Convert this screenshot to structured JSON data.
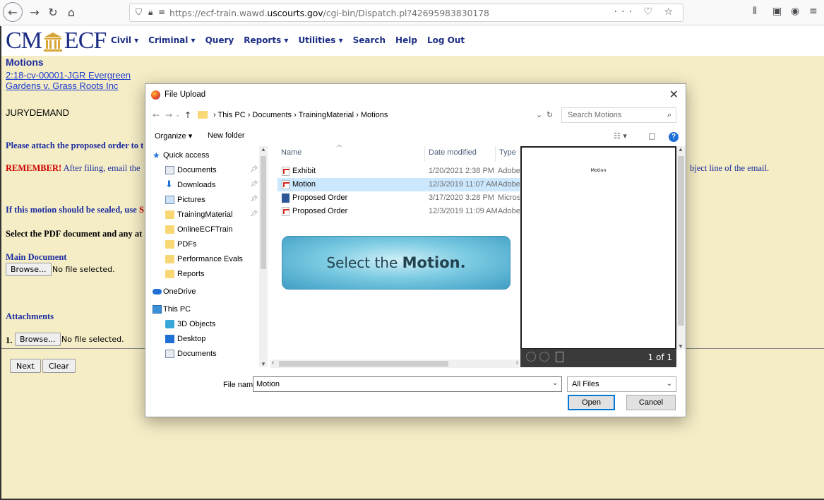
{
  "browser": {
    "url_prefix": "https://ecf-train.wawd.",
    "url_domain": "uscourts.gov",
    "url_suffix": "/cgi-bin/Dispatch.pl?42695983830178",
    "url_tools": "··· ♡ ☆"
  },
  "ecf": {
    "logo_left": "CM",
    "logo_right": "ECF",
    "menu": [
      "Civil ▾",
      "Criminal ▾",
      "Query",
      "Reports ▾",
      "Utilities ▾",
      "Search",
      "Help",
      "Log Out"
    ],
    "page_title": "Motions",
    "case_link_line1": "2:18-cv-00001-JGR Evergreen",
    "case_link_line2": "Gardens v. Grass Roots Inc",
    "jury_demand": "JURYDEMAND",
    "attach_prompt": "Please attach the proposed order to t",
    "remember_label": "REMEMBER!",
    "remember_text": " After filing, email the",
    "remember_tail": "bject line of the email.",
    "sealed_text": "If this motion should be sealed, use ",
    "sealed_red": "S",
    "select_text": "Select the PDF document and any at",
    "main_document": "Main Document",
    "browse_label": "Browse...",
    "no_file": "No file selected.",
    "attachments_title": "Attachments",
    "attachment_num": "1.",
    "next_label": "Next",
    "clear_label": "Clear"
  },
  "dialog": {
    "title": "File Upload",
    "close": "✕",
    "breadcrumb": "›  This PC  ›  Documents  ›  TrainingMaterial  ›  Motions",
    "search_placeholder": "Search Motions",
    "organize": "Organize ▾",
    "new_folder": "New folder",
    "nav": [
      {
        "label": "Quick access",
        "icon": "star-icon",
        "pinned": false
      },
      {
        "label": "Documents",
        "icon": "documents-icon",
        "pinned": true
      },
      {
        "label": "Downloads",
        "icon": "download-icon",
        "pinned": true
      },
      {
        "label": "Pictures",
        "icon": "pictures-icon",
        "pinned": true
      },
      {
        "label": "TrainingMaterial",
        "icon": "folder-icon",
        "pinned": true
      },
      {
        "label": "OnlineECFTrain",
        "icon": "folder-icon",
        "pinned": false
      },
      {
        "label": "PDFs",
        "icon": "folder-icon",
        "pinned": false
      },
      {
        "label": "Performance Evals",
        "icon": "folder-icon",
        "pinned": false
      },
      {
        "label": "Reports",
        "icon": "folder-icon",
        "pinned": false
      },
      {
        "label": "OneDrive",
        "icon": "cloud-icon",
        "pinned": false
      },
      {
        "label": "This PC",
        "icon": "computer-icon",
        "pinned": false
      },
      {
        "label": "3D Objects",
        "icon": "3d-objects-icon",
        "pinned": false
      },
      {
        "label": "Desktop",
        "icon": "desktop-icon",
        "pinned": false
      },
      {
        "label": "Documents",
        "icon": "documents-icon",
        "pinned": false
      }
    ],
    "columns": {
      "name": "Name",
      "date": "Date modified",
      "type": "Type"
    },
    "files": [
      {
        "name": "Exhibit",
        "date": "1/20/2021 2:38 PM",
        "type": "Adobe",
        "kind": "pdf",
        "selected": false
      },
      {
        "name": "Motion",
        "date": "12/3/2019 11:07 AM",
        "type": "Adobe",
        "kind": "pdf",
        "selected": true
      },
      {
        "name": "Proposed Order",
        "date": "3/17/2020 3:28 PM",
        "type": "Micros",
        "kind": "word",
        "selected": false
      },
      {
        "name": "Proposed Order",
        "date": "12/3/2019 11:09 AM",
        "type": "Adobe",
        "kind": "pdf",
        "selected": false
      }
    ],
    "callout_prefix": "Select the ",
    "callout_emphasis": "Motion.",
    "preview_text": "Motion",
    "preview_page": "1 of 1",
    "file_name_label": "File name:",
    "file_name_value": "Motion",
    "filter_value": "All Files",
    "open_label": "Open",
    "cancel_label": "Cancel"
  },
  "colors": {
    "page_bg": "#f5edc6",
    "ecf_blue": "#1c2d84",
    "selection": "#cce8ff",
    "callout": "#7ccbe2"
  }
}
